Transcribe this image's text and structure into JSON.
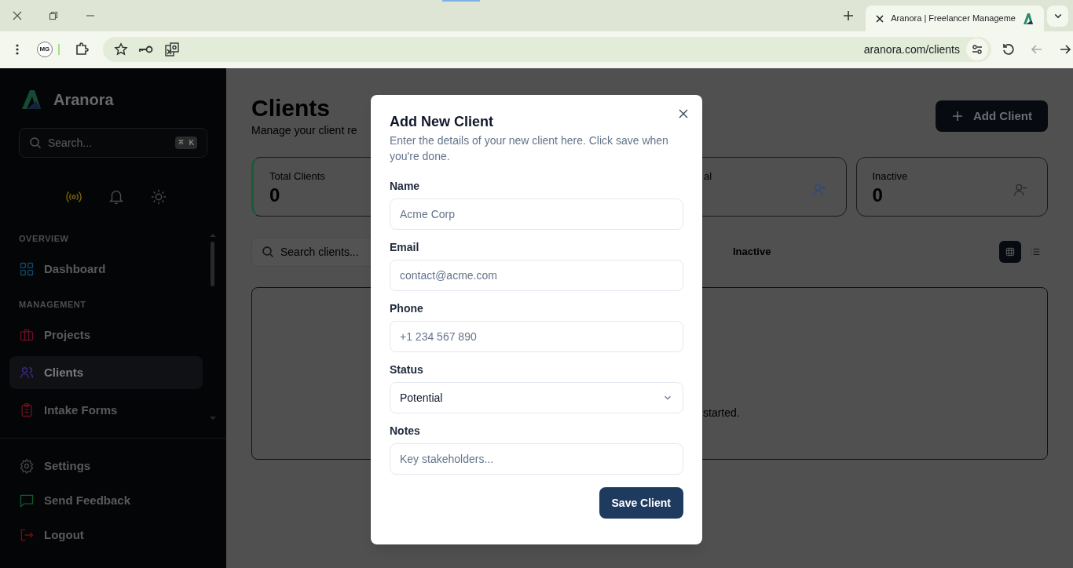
{
  "browser": {
    "tabs": [
      {
        "title": "Aranora | Freelancer Manageme",
        "selected": true
      }
    ],
    "profile": "MG",
    "url": "aranora.com/clients",
    "back_disabled": true
  },
  "sidebar": {
    "brand": "Aranora",
    "search": {
      "placeholder": "Search...",
      "shortcut": "⌘ K"
    },
    "sections": [
      {
        "heading": "OVERVIEW",
        "items": [
          {
            "label": "Dashboard",
            "selected": false
          }
        ]
      },
      {
        "heading": "MANAGEMENT",
        "items": [
          {
            "label": "Projects",
            "selected": false
          },
          {
            "label": "Clients",
            "selected": true
          },
          {
            "label": "Intake Forms",
            "selected": false
          }
        ]
      }
    ],
    "footer": [
      {
        "label": "Settings"
      },
      {
        "label": "Send Feedback"
      },
      {
        "label": "Logout"
      }
    ]
  },
  "page": {
    "title": "Clients",
    "subtitle": "Manage your client re",
    "add_button": "Add Client",
    "stats": [
      {
        "label": "Total Clients",
        "value": "0"
      },
      {
        "label": "al"
      },
      {
        "label": "Inactive",
        "value": "0"
      }
    ],
    "search_placeholder": "Search clients...",
    "filter_tabs": [
      {
        "label": "Inactive",
        "selected": false
      }
    ],
    "view_toggle": [
      {
        "selected": true
      },
      {
        "selected": false
      }
    ],
    "empty_text": "started."
  },
  "dialog": {
    "title": "Add New Client",
    "description": "Enter the details of your new client here. Click save when you're done.",
    "fields": [
      {
        "label": "Name",
        "kind": "input",
        "placeholder": "Acme Corp"
      },
      {
        "label": "Email",
        "kind": "input",
        "placeholder": "contact@acme.com"
      },
      {
        "label": "Phone",
        "kind": "input",
        "placeholder": "+1 234 567 890"
      },
      {
        "label": "Status",
        "kind": "select",
        "value": "Potential"
      },
      {
        "label": "Notes",
        "kind": "input",
        "placeholder": "Key stakeholders..."
      }
    ],
    "submit": "Save Client"
  }
}
